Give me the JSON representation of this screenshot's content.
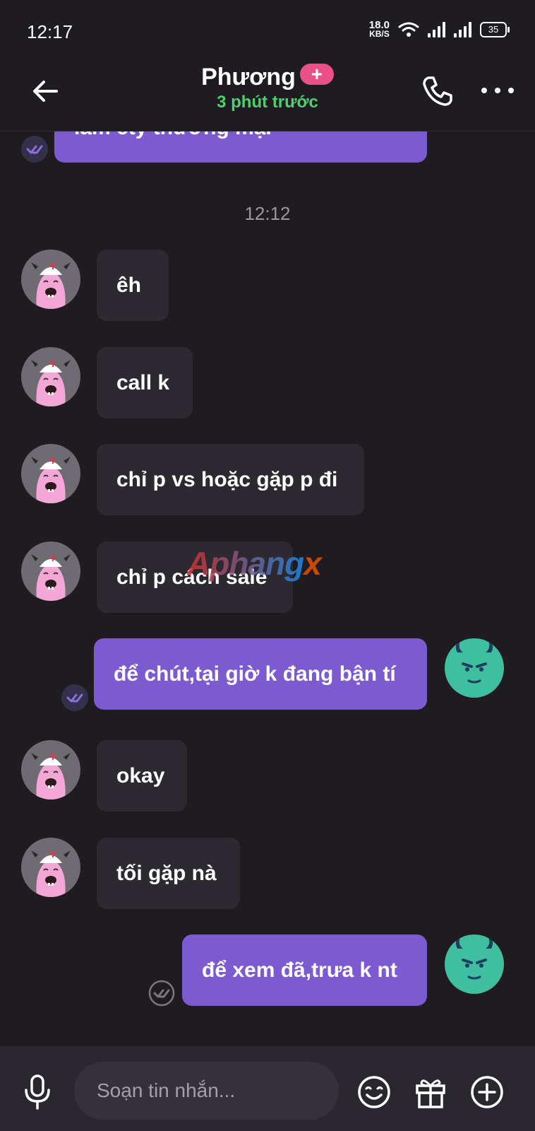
{
  "status_bar": {
    "time": "12:17",
    "net_speed_value": "18.0",
    "net_speed_unit": "KB/S",
    "battery": "35"
  },
  "header": {
    "contact_name": "Phương",
    "plus_badge": "+",
    "last_seen": "3 phút trước"
  },
  "conversation": {
    "partial_top_message": "làm cty thương mại",
    "timestamp": "12:12",
    "messages": [
      {
        "direction": "in",
        "text": "êh"
      },
      {
        "direction": "in",
        "text": "call k"
      },
      {
        "direction": "in",
        "text": "chỉ p vs hoặc gặp p đi"
      },
      {
        "direction": "in",
        "text": "chỉ p cách sale"
      },
      {
        "direction": "out",
        "text": "để chút,tại giờ k đang bận tí"
      },
      {
        "direction": "in",
        "text": "okay"
      },
      {
        "direction": "in",
        "text": "tối gặp nà"
      },
      {
        "direction": "out",
        "text": "để xem đã,trưa k nt"
      }
    ]
  },
  "watermark": {
    "part1": "Aphang",
    "part2": "x"
  },
  "composer": {
    "placeholder": "Soạn tin nhắn..."
  },
  "colors": {
    "background": "#1e1c21",
    "incoming_bubble": "#2c2a30",
    "outgoing_bubble": "#7c5bd0",
    "online_green": "#4fcf6f",
    "badge_pink": "#ea4f86"
  },
  "icons": [
    "back-arrow-icon",
    "phone-icon",
    "more-icon",
    "read-tick-icon",
    "mic-icon",
    "emoji-icon",
    "gift-icon",
    "add-icon"
  ]
}
